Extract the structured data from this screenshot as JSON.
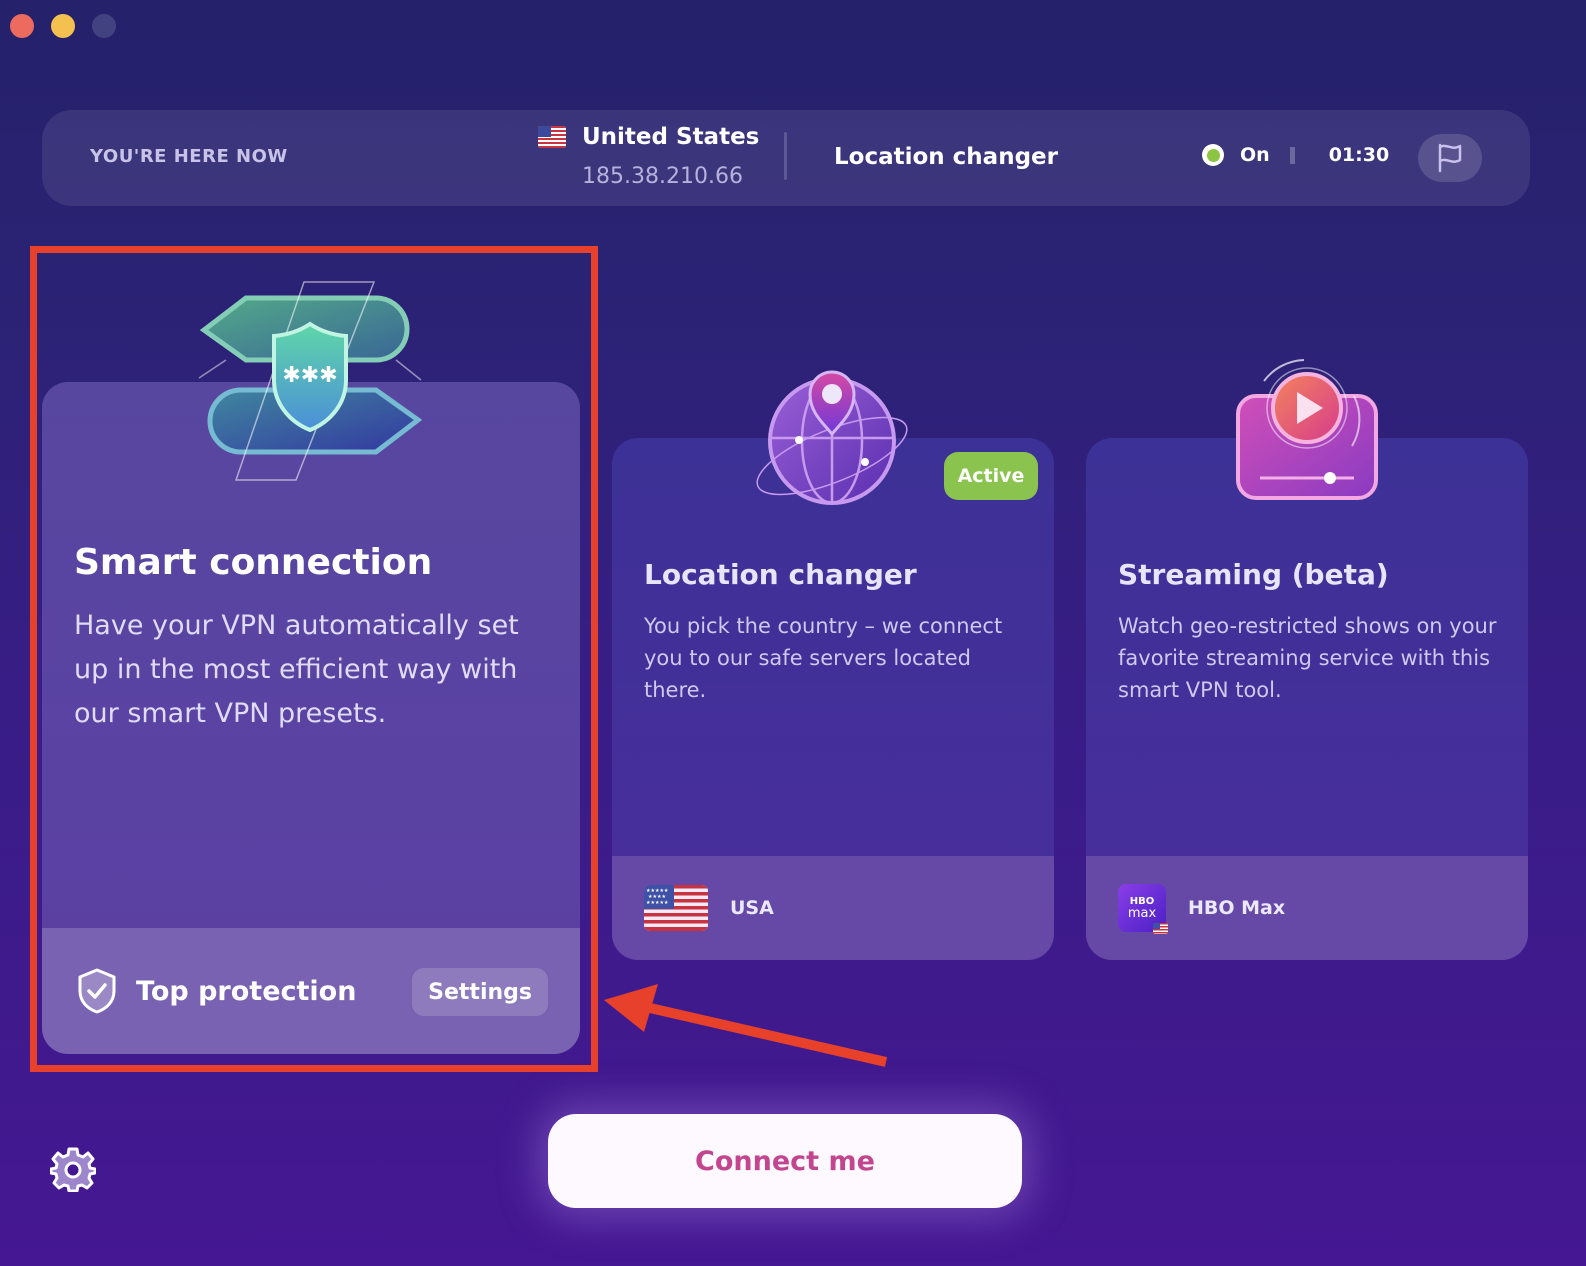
{
  "window": {
    "controls": [
      "close",
      "minimize",
      "maximize"
    ]
  },
  "topbar": {
    "here_label": "YOU'RE HERE NOW",
    "country": "United States",
    "ip": "185.38.210.66",
    "mode": "Location changer",
    "status": "On",
    "status_color": "#8bc541",
    "timer": "01:30",
    "flag_icon": "flag-icon"
  },
  "cards": [
    {
      "id": "smart-connection",
      "title": "Smart connection",
      "description": "Have your VPN automatically set up in the most efficient way with our smart VPN presets.",
      "footer_label": "Top protection",
      "footer_icon": "shield-check-icon",
      "action_label": "Settings",
      "selected": true
    },
    {
      "id": "location-changer",
      "title": "Location changer",
      "description": "You pick the country – we connect you to our safe servers located there.",
      "badge": "Active",
      "badge_color": "#8bc34f",
      "footer_label": "USA",
      "footer_icon": "us-flag-icon"
    },
    {
      "id": "streaming",
      "title": "Streaming (beta)",
      "description": "Watch geo-restricted shows on your favorite streaming service with this smart VPN tool.",
      "footer_label": "HBO Max",
      "footer_icon": "hbo-max-logo",
      "logo_text": [
        "HBO",
        "max"
      ]
    }
  ],
  "connect_button": "Connect me",
  "settings_icon": "gear-icon",
  "annotation": {
    "highlight_color": "#e8412b"
  }
}
